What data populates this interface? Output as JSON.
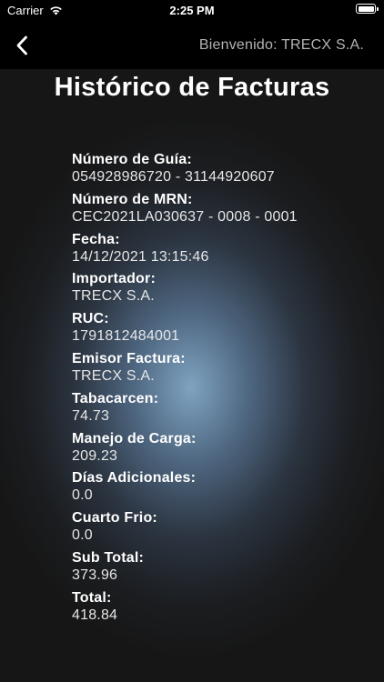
{
  "status_bar": {
    "carrier": "Carrier",
    "time": "2:25 PM",
    "wifi_icon": "wifi-icon",
    "battery_icon": "battery-icon"
  },
  "nav": {
    "back_icon": "chevron-left-icon",
    "greeting": "Bienvenido: TRECX S.A."
  },
  "page": {
    "title": "Histórico de Facturas"
  },
  "fields": [
    {
      "label": "Número de Guía:",
      "value": "054928986720 - 31144920607"
    },
    {
      "label": "Número de MRN:",
      "value": "CEC2021LA030637 - 0008 - 0001"
    },
    {
      "label": "Fecha:",
      "value": "14/12/2021 13:15:46"
    },
    {
      "label": "Importador:",
      "value": "TRECX S.A."
    },
    {
      "label": "RUC:",
      "value": "1791812484001"
    },
    {
      "label": "Emisor Factura:",
      "value": "TRECX S.A."
    },
    {
      "label": "Tabacarcen:",
      "value": "74.73"
    },
    {
      "label": "Manejo de Carga:",
      "value": "209.23"
    },
    {
      "label": "Días Adicionales:",
      "value": "0.0"
    },
    {
      "label": "Cuarto Frio:",
      "value": "0.0"
    },
    {
      "label": "Sub Total:",
      "value": "373.96"
    },
    {
      "label": "Total:",
      "value": "418.84"
    }
  ]
}
